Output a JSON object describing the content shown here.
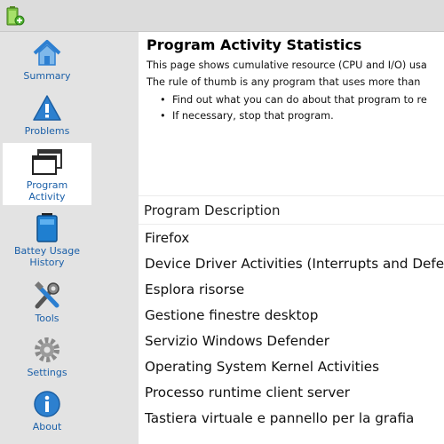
{
  "sidebar": {
    "items": [
      {
        "label_lines": [
          "Summary"
        ],
        "icon": "home-icon"
      },
      {
        "label_lines": [
          "Problems"
        ],
        "icon": "warning-icon"
      },
      {
        "label_lines": [
          "Program",
          "Activity"
        ],
        "icon": "windows-icon",
        "active": true
      },
      {
        "label_lines": [
          "Battey Usage",
          "History"
        ],
        "icon": "battery-icon"
      },
      {
        "label_lines": [
          "Tools"
        ],
        "icon": "tools-icon"
      },
      {
        "label_lines": [
          "Settings"
        ],
        "icon": "gear-icon"
      },
      {
        "label_lines": [
          "About"
        ],
        "icon": "info-icon"
      }
    ]
  },
  "main": {
    "title": "Program Activity Statistics",
    "desc_line1": "This page shows cumulative resource (CPU and I/O) usa",
    "desc_line2": "The rule of thumb is any program that uses more than ",
    "bullets": [
      "Find out what you can do about that program to re",
      "If necessary, stop that program."
    ],
    "table": {
      "header": "Program Description",
      "rows": [
        "Firefox",
        "Device Driver Activities (Interrupts and Defe",
        "Esplora risorse",
        "Gestione finestre desktop",
        "Servizio Windows Defender",
        "Operating System Kernel Activities",
        "Processo runtime client server",
        "Tastiera virtuale e pannello per la grafia"
      ]
    }
  },
  "colors": {
    "accent": "#1a5fa8",
    "sidebar_bg": "#e3e3e3",
    "titlebar_bg": "#dcdcdc"
  }
}
